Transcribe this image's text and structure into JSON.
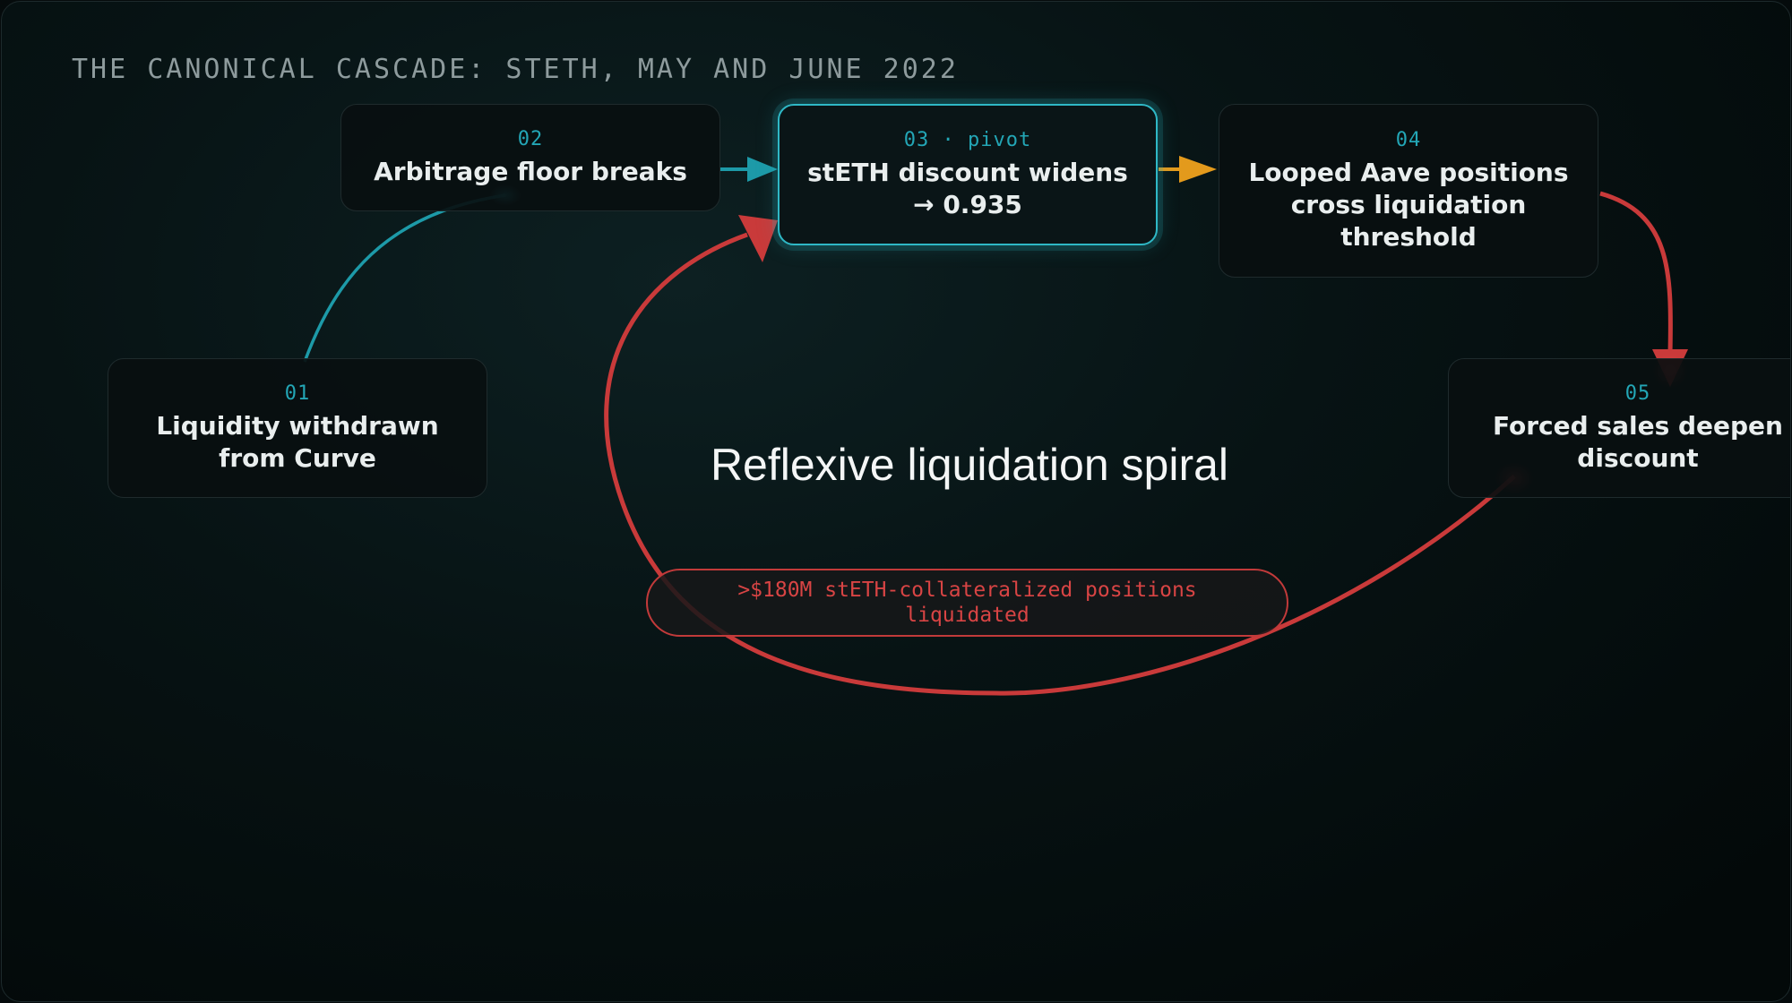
{
  "title": "THE CANONICAL CASCADE: STETH, MAY AND JUNE 2022",
  "nodes": [
    {
      "num": "01",
      "label": "Liquidity withdrawn from Curve"
    },
    {
      "num": "02",
      "label": "Arbitrage floor breaks"
    },
    {
      "num": "03 · pivot",
      "label": "stETH discount widens → 0.935"
    },
    {
      "num": "04",
      "label": "Looped Aave positions cross liquidation threshold"
    },
    {
      "num": "05",
      "label": "Forced sales deepen discount"
    }
  ],
  "loop": {
    "title": "Reflexive liquidation spiral",
    "note": ">$180M stETH-collateralized positions liquidated"
  },
  "colors": {
    "accent": "#2fb8c6",
    "teal_arrow": "#1d9aa8",
    "amber_arrow": "#e39a1c",
    "spiral": "#c93a3a"
  }
}
